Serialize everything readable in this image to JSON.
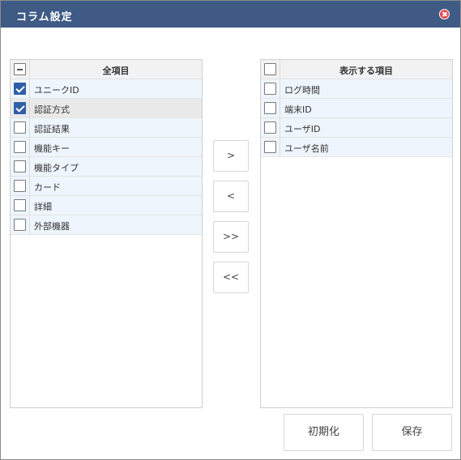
{
  "dialog": {
    "title": "コラム設定",
    "close_icon": "close-icon"
  },
  "left_panel": {
    "header": "全項目",
    "header_checkbox": "partial",
    "items": [
      {
        "label": "ユニークID",
        "checked": true
      },
      {
        "label": "認証方式",
        "checked": true
      },
      {
        "label": "認証結果",
        "checked": false
      },
      {
        "label": "機能キー",
        "checked": false
      },
      {
        "label": "機能タイプ",
        "checked": false
      },
      {
        "label": "カード",
        "checked": false
      },
      {
        "label": "詳細",
        "checked": false
      },
      {
        "label": "外部機器",
        "checked": false
      }
    ]
  },
  "right_panel": {
    "header": "表示する項目",
    "header_checkbox": "unchecked",
    "items": [
      {
        "label": "ログ時間",
        "checked": false
      },
      {
        "label": "端末ID",
        "checked": false
      },
      {
        "label": "ユーザID",
        "checked": false
      },
      {
        "label": "ユーザ名前",
        "checked": false
      }
    ]
  },
  "move_buttons": {
    "add": ">",
    "remove": "<",
    "add_all": ">>",
    "remove_all": "<<"
  },
  "footer": {
    "reset_label": "初期化",
    "save_label": "保存"
  }
}
